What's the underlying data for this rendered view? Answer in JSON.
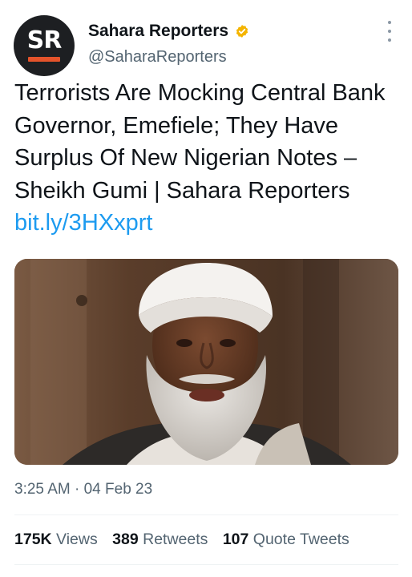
{
  "author": {
    "display_name": "Sahara Reporters",
    "handle": "@SaharaReporters",
    "avatar_text": "SR",
    "verified": true,
    "verified_color": "#f4b400"
  },
  "tweet": {
    "text": "Terrorists Are Mocking Central Bank Governor, Emefiele; They Have Surplus Of New Nigerian Notes – Sheikh Gumi | Sahara Reporters ",
    "link": "bit.ly/3HXxprt",
    "link_color": "#1d9bf0",
    "media_description_icon": "photo-icon"
  },
  "meta": {
    "time": "3:25 AM",
    "separator": "·",
    "date": "04 Feb 23"
  },
  "stats": {
    "views_count": "175K",
    "views_label": "Views",
    "retweets_count": "389",
    "retweets_label": "Retweets",
    "quotes_count": "107",
    "quotes_label": "Quote Tweets"
  },
  "icons": {
    "more": "more-options-icon",
    "verified": "verified-badge-icon"
  }
}
